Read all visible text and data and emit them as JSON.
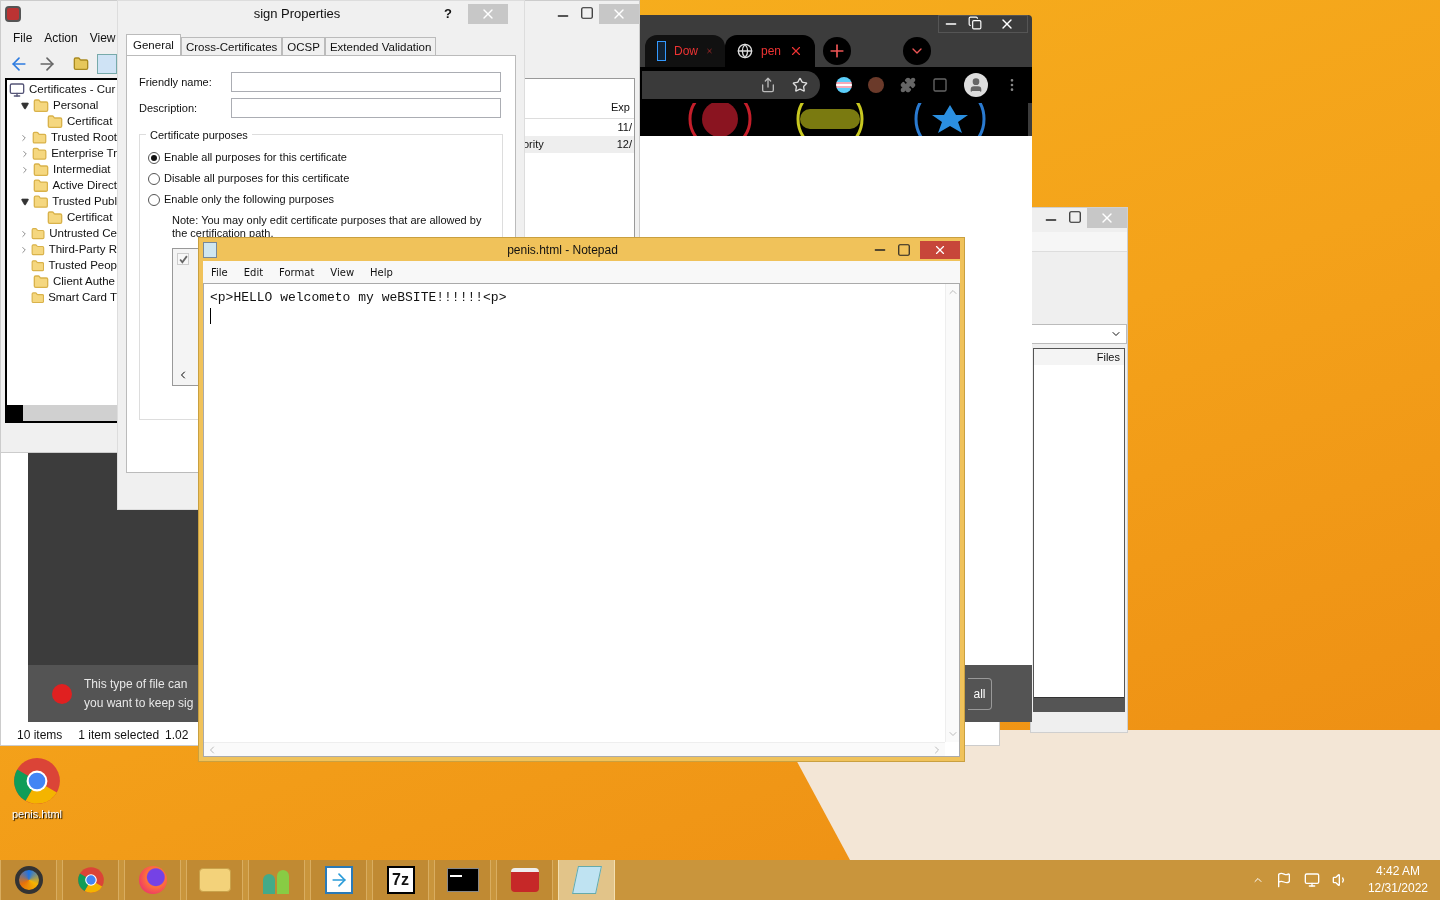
{
  "cert_manager": {
    "menu": [
      "File",
      "Action",
      "View"
    ],
    "tree": [
      {
        "label": "Certificates - Cur",
        "children": [
          {
            "label": "Personal",
            "expanded": true,
            "children": [
              {
                "label": "Certificat"
              }
            ]
          },
          {
            "label": "Trusted Root",
            "expanded": false
          },
          {
            "label": "Enterprise Tr",
            "expanded": false
          },
          {
            "label": "Intermediat",
            "expanded": false
          },
          {
            "label": "Active Direct"
          },
          {
            "label": "Trusted Publ",
            "expanded": true,
            "children": [
              {
                "label": "Certificat"
              }
            ]
          },
          {
            "label": "Untrusted Ce",
            "expanded": false
          },
          {
            "label": "Third-Party R",
            "expanded": false
          },
          {
            "label": "Trusted Peop"
          },
          {
            "label": "Client Authe"
          },
          {
            "label": "Smart Card T"
          }
        ]
      }
    ],
    "list": {
      "columns": [
        "Exp"
      ],
      "rows": [
        {
          "expiry": "11/",
          "selected": false
        },
        {
          "column_1": "ority",
          "expiry": "12/",
          "selected": true
        }
      ]
    }
  },
  "properties": {
    "title": "sign Properties",
    "help": "?",
    "tabs": [
      {
        "label": "General",
        "selected": true
      },
      {
        "label": "Cross-Certificates",
        "selected": false
      },
      {
        "label": "OCSP",
        "selected": false
      },
      {
        "label": "Extended Validation",
        "selected": false
      }
    ],
    "fields": [
      {
        "label": "Friendly name:"
      },
      {
        "label": "Description:"
      }
    ],
    "purposes": {
      "legend": "Certificate purposes",
      "options": [
        {
          "label": "Enable all purposes for this certificate",
          "selected": true
        },
        {
          "label": "Disable all purposes for this certificate",
          "selected": false
        },
        {
          "label": "Enable only the following purposes",
          "selected": false
        }
      ],
      "note": "Note: You may only edit certificate purposes that are allowed by the certification path.",
      "list_items": [
        {
          "checked": true,
          "disabled": true
        }
      ]
    }
  },
  "chrome": {
    "tabs": [
      {
        "title": "Dow",
        "selected": false
      },
      {
        "title": "pen",
        "selected": true
      }
    ],
    "download_bar": {
      "message_lines": [
        "This type of file can",
        "you want to keep sig"
      ],
      "button": "all"
    }
  },
  "right_window": {
    "columns": [
      "Files"
    ]
  },
  "explorer": {
    "item_count": "10 items",
    "selection": "1 item selected",
    "size": "1.02"
  },
  "notepad": {
    "title": "penis.html - Notepad",
    "menu": [
      "File",
      "Edit",
      "Format",
      "View",
      "Help"
    ],
    "text": "<p>HELLO welcometo my weBSITE!!!!!!<p>"
  },
  "desktop_icons": [
    {
      "label": "penis.html"
    }
  ],
  "taskbar": {
    "apps": [
      {
        "kind": "canary",
        "selected": false
      },
      {
        "kind": "chrome",
        "selected": false
      },
      {
        "kind": "firefox",
        "selected": false
      },
      {
        "kind": "explorer",
        "selected": false
      },
      {
        "kind": "people",
        "selected": false
      },
      {
        "kind": "transfer",
        "selected": false
      },
      {
        "kind": "archiver",
        "label": "7z",
        "selected": false
      },
      {
        "kind": "console",
        "selected": false
      },
      {
        "kind": "toolbox",
        "selected": false
      },
      {
        "kind": "notepad",
        "selected": true
      }
    ],
    "clock": {
      "time": "4:42 AM",
      "date": "12/31/2022"
    }
  }
}
